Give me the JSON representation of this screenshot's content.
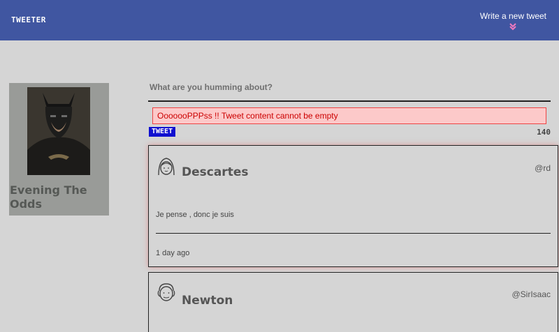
{
  "nav": {
    "brand": "TWEETER",
    "compose_label": "Write a new tweet"
  },
  "profile": {
    "name": "Evening The Odds"
  },
  "composer": {
    "prompt": "What are you humming about?",
    "error": "OoooooPPPss !! Tweet content cannot be empty",
    "button_label": "TWEET",
    "char_count": "140"
  },
  "tweets": [
    {
      "name": "Descartes",
      "handle": "@rd",
      "content": "Je pense , donc je suis",
      "time": "1 day ago",
      "avatar_icon": "girl-face-icon"
    },
    {
      "name": "Newton",
      "handle": "@SirIsaac",
      "avatar_icon": "man-face-icon"
    }
  ],
  "colors": {
    "header": "#4056a1",
    "background": "#d5d5d5",
    "error_bg": "#fcc9c9",
    "error_text": "#cc0000",
    "tweet_button": "#1010d0",
    "chevron": "#f07ac0"
  }
}
